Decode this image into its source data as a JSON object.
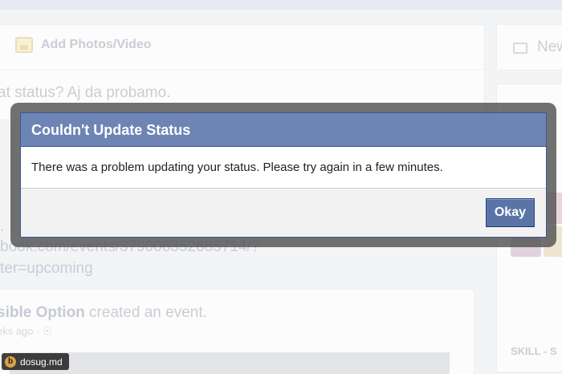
{
  "background": {
    "composer": {
      "add_photo_label": "Add Photos/Video",
      "prompt_text": "at status? Aj da probamo."
    },
    "link_lines": [
      ".",
      "book.com/events/379006352685714/?",
      "ter=upcoming"
    ],
    "event": {
      "actor": "sible Option",
      "action": " created an event.",
      "meta": "eks ago · ☉"
    },
    "right_column": {
      "news_label": "New",
      "skill_label": "SKILL - S"
    }
  },
  "dialog": {
    "title": "Couldn't Update Status",
    "message": "There was a problem updating your status. Please try again in a few minutes.",
    "okay_label": "Okay"
  },
  "watermark": {
    "logo": "b",
    "text": "dosug.md"
  },
  "colors": {
    "dialog_header": "#6d84b4",
    "dialog_border": "#3b5998",
    "button": "#5b74a8",
    "overlay_frame": "#525252"
  },
  "icons": [
    "photo-icon",
    "news-feed-icon"
  ]
}
